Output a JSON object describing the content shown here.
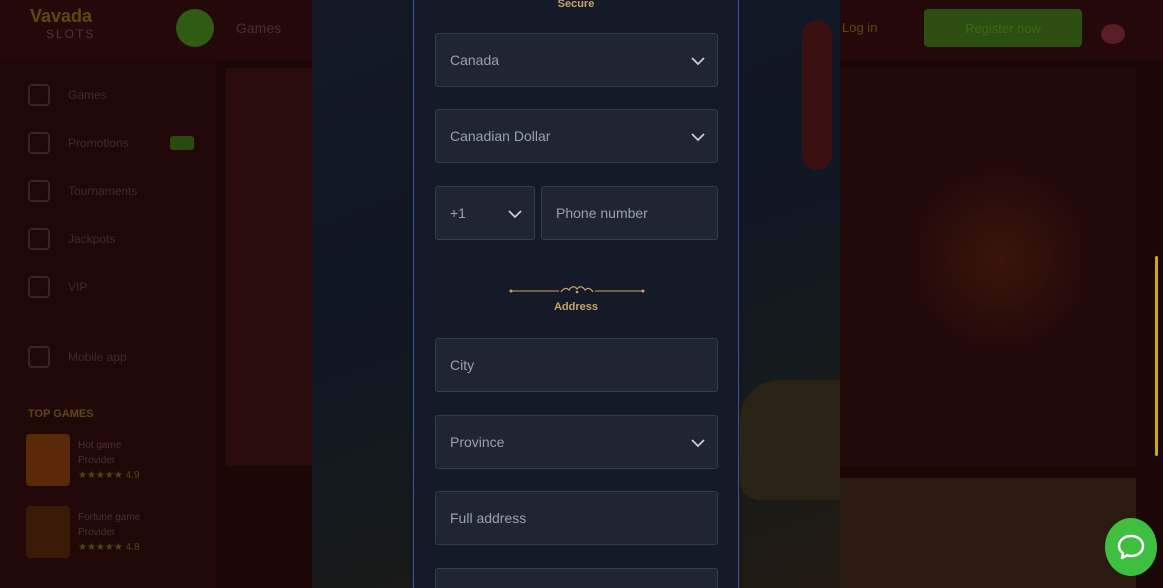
{
  "background": {
    "logo_line1": "Vavada",
    "logo_line2": "SLOTS",
    "nav_games": "Games",
    "login": "Log in",
    "register": "Register now",
    "sidebar": {
      "items": [
        {
          "label": "Games",
          "icon": "search-icon"
        },
        {
          "label": "Promotions",
          "icon": "gift-icon"
        },
        {
          "label": "Tournaments",
          "icon": "trophy-icon"
        },
        {
          "label": "Jackpots",
          "icon": "crown-icon"
        },
        {
          "label": "VIP",
          "icon": "diamond-icon"
        },
        {
          "label": "Mobile app",
          "icon": "phone-icon"
        }
      ],
      "section_title": "TOP GAMES",
      "games": [
        {
          "title": "Hot game",
          "provider": "Provider",
          "rating": "★★★★★ 4.9"
        },
        {
          "title": "Fortune game",
          "provider": "Provider",
          "rating": "★★★★★ 4.8"
        }
      ]
    }
  },
  "modal": {
    "secure_label": "Secure",
    "country": {
      "value": "Canada"
    },
    "currency": {
      "value": "Canadian Dollar"
    },
    "phone_code": {
      "value": "+1"
    },
    "phone": {
      "placeholder": "Phone number"
    },
    "address_title": "Address",
    "city": {
      "placeholder": "City"
    },
    "province": {
      "placeholder": "Province"
    },
    "full_address": {
      "placeholder": "Full address"
    },
    "postal": {
      "placeholder": ""
    }
  },
  "colors": {
    "accent_gold": "#c9a36b",
    "modal_bg": "#141a28",
    "field_bg": "#1f2632",
    "chat_green": "#3fbf3f",
    "scrollbar": "#c9b000"
  },
  "icons": {
    "dropdown": "chevron-down-icon",
    "divider": "ornament-divider-icon",
    "chat": "chat-bubble-icon"
  }
}
